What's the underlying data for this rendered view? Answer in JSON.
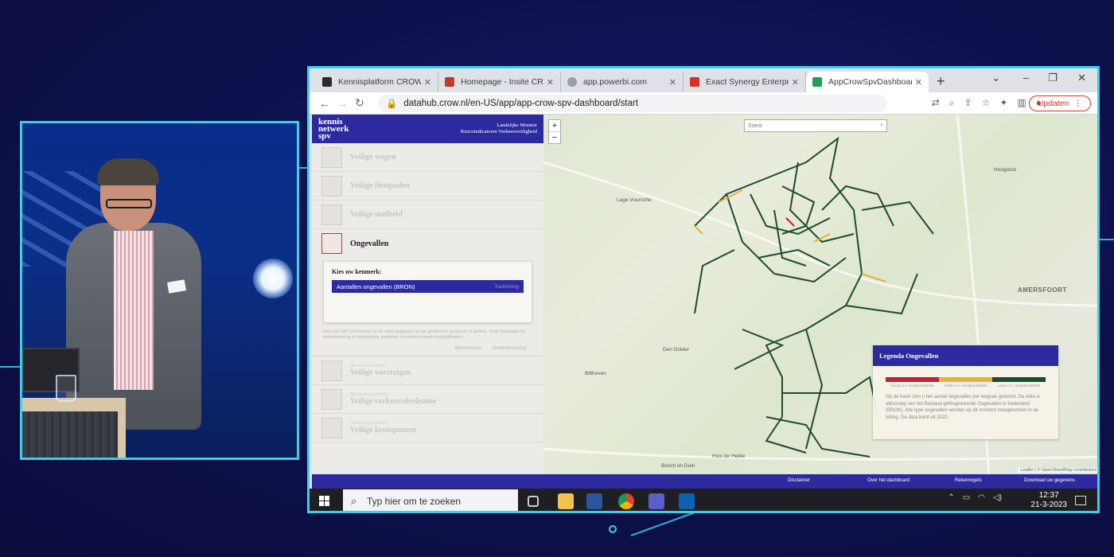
{
  "browser": {
    "tabs": [
      {
        "title": "Kennisplatform CROW | P",
        "fav_color": "#2b2b2b"
      },
      {
        "title": "Homepage - Insite CROW",
        "fav_color": "#c0392b"
      },
      {
        "title": "app.powerbi.com",
        "fav_color": "#5f6368"
      },
      {
        "title": "Exact Synergy Enterprise",
        "fav_color": "#d93025"
      },
      {
        "title": "AppCrowSpvDashboard",
        "fav_color": "#1e9e5a"
      }
    ],
    "url": "datahub.crow.nl/en-US/app/app-crow-spv-dashboard/start",
    "update_label": "Updaten"
  },
  "sidebar": {
    "logo_line1": "kennis",
    "logo_line2": "netwerk",
    "logo_line3": "spv",
    "monitor_line1": "Landelijke Monitor",
    "monitor_line2": "Risicoindicatoren Verkeersveiligheid",
    "items_top": [
      "Veilige wegen",
      "Veilige fietspaden",
      "Veilige snelheid"
    ],
    "active_item": "Ongevallen",
    "kenmerk_label": "Kies uw kenmerk:",
    "kenmerk_value": "Aantallen ongevallen (BRON)",
    "kenmerk_hint": "Toelichting",
    "help_text": "Kies een SPI of kenmerk en de data toegepast op uw gemeente, provincie of gebied. Vindt daarnaast de onderbouwing en toegepaste grafieken via onderstaande mogelijkheden.",
    "link_benchmark": "Benchmark",
    "link_onderbouwing": "Onderbouwing",
    "items_bottom": [
      "Veilige voertuigen",
      "Veilige verkeersdeelname",
      "Veilige kruispunten"
    ],
    "items_bottom_pre": "(Wordt nog verwerkt)"
  },
  "map": {
    "search_placeholder": "Soest",
    "zoom_in": "+",
    "zoom_out": "−",
    "places": [
      "Lage Vuursche",
      "Den Dolder",
      "Bilthoven",
      "Hoogland",
      "AMERSFOORT",
      "Huis ter Heide",
      "Bosch en Duin"
    ],
    "attribution": "Leaflet | © OpenStreetMap contributors",
    "legend": {
      "title": "Legenda Ongevallen",
      "colors": [
        "#b8243a",
        "#e3b23c",
        "#1f4a2e"
      ],
      "labels": [
        "Hoog t.o.v. landgemiddelde",
        "Gelijk t.o.v. landgemiddelde",
        "Laag t.o.v. landgemiddelde"
      ],
      "text": "Op de kaart zien u het aantal ongevallen per wegvak getoond. De data is afkomstig van het Bestand geRegistreerde Ongevallen in Nederland (BRON). Alle type ongevallen worden op dit moment meegenomen in de telling. De data komt uit 2020."
    }
  },
  "footer": {
    "disclaimer": "Disclaimer",
    "about": "Over het dashboard",
    "rules": "Rekenregels",
    "download": "Download uw gegevens"
  },
  "taskbar": {
    "search_placeholder": "Typ hier om te zoeken",
    "time": "12:37",
    "date": "21-3-2023"
  }
}
